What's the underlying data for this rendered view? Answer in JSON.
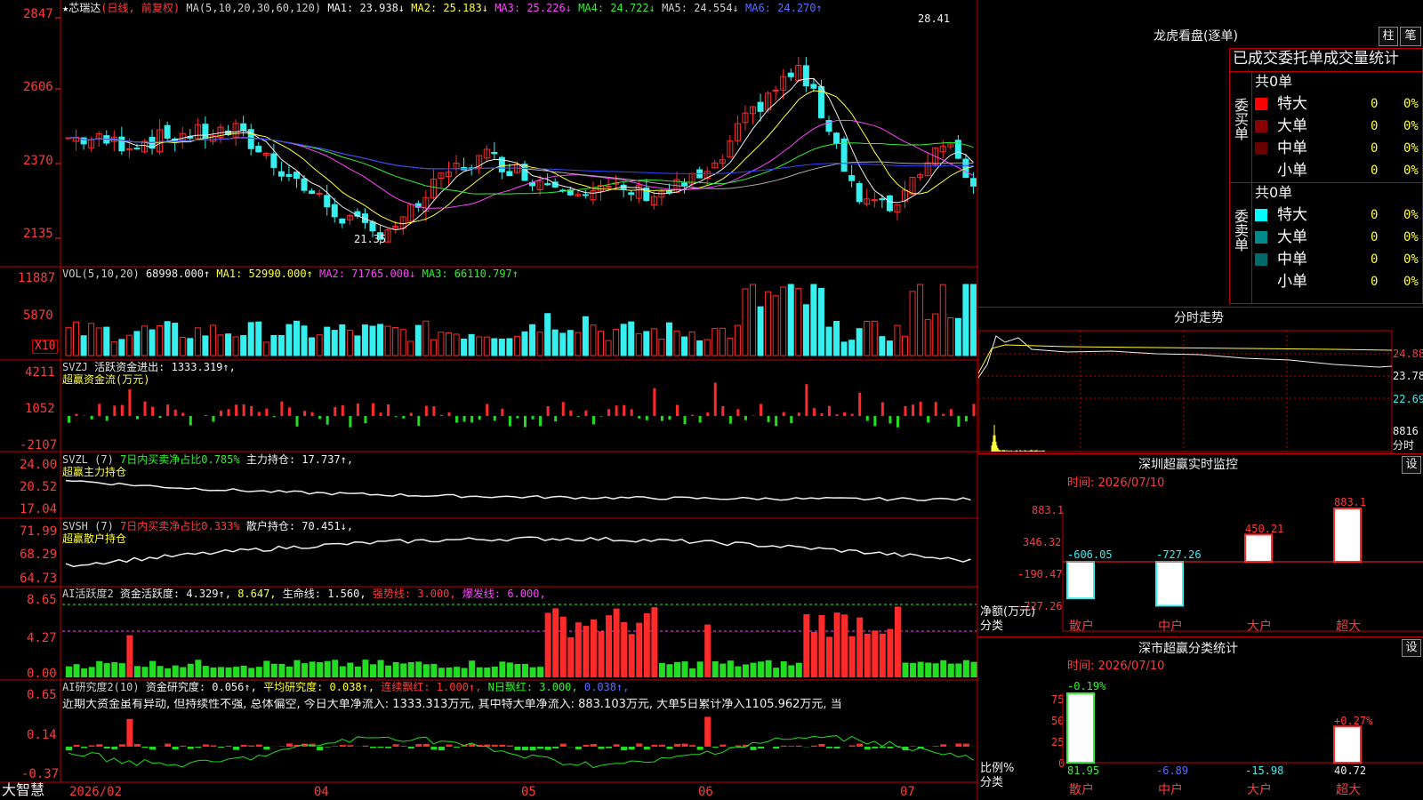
{
  "colors": {
    "up": "#ff2a2a",
    "down": "#36f0f0",
    "frame": "#c00000",
    "yellow": "#ffff33",
    "green": "#33ee33",
    "magenta": "#ff44ff",
    "white": "#f0f0f0",
    "blue": "#3344ff"
  },
  "stock": {
    "name": "★芯瑞达",
    "mode": "(日线, 前复权)"
  },
  "ma_legend": {
    "period": "MA(5,10,20,30,60,120)",
    "ma1": "MA1: 23.938↓",
    "ma2": "MA2: 25.183↓",
    "ma3": "MA3: 25.226↓",
    "ma4": "MA4: 24.722↓",
    "ma5": "MA5: 24.554↓",
    "ma6": "MA6: 24.270↑"
  },
  "price_axis": [
    "2847",
    "2606",
    "2370",
    "2135"
  ],
  "price_annotations": {
    "high": "28.41",
    "low": "21.35"
  },
  "vol": {
    "label": "VOL(5,10,20)",
    "value": "68998.000↑",
    "ma1": "MA1: 52990.000↑",
    "ma2": "MA2: 71765.000↓",
    "ma3": "MA3: 66110.797↑",
    "axis": [
      "11887",
      "5870"
    ],
    "unit": "X10"
  },
  "svzj": {
    "label": "SVZJ",
    "text": "活跃资金进出: 1333.319↑,",
    "sub": "超赢资金流(万元)",
    "axis": [
      "4211",
      "1052",
      "-2107"
    ]
  },
  "svzl": {
    "label": "SVZL (7)",
    "text1": "7日内买卖净占比0.785%",
    "text2": "主力持仓: 17.737↑,",
    "sub": "超赢主力持仓",
    "axis": [
      "24.00",
      "20.52",
      "17.04"
    ]
  },
  "svsh": {
    "label": "SVSH (7)",
    "text1": "7日内买卖净占比0.333%",
    "text2": "散户持仓: 70.451↓,",
    "sub": "超赢散户持仓",
    "axis": [
      "71.99",
      "68.29",
      "64.73"
    ]
  },
  "ai_active": {
    "label": "AI活跃度2",
    "text1": "资金活跃度: 4.329↑,",
    "text2": "8.647,",
    "text3": "生命线: 1.560,",
    "text4": "强势线: 3.000,",
    "text5": "爆发线: 6.000,",
    "axis": [
      "8.65",
      "4.27",
      "0.00"
    ]
  },
  "ai_research": {
    "label": "AI研究度2(10)",
    "text1": "资金研究度: 0.056↑,",
    "text2": "平均研究度: 0.038↑,",
    "text3": "连续飘红: 1.000↑,",
    "text4": "N日飘红: 3.000,",
    "text5": "0.038↑,",
    "commentary": "近期大资金虽有异动, 但持续性不强, 总体偏空, 今日大单净流入: 1333.313万元, 其中特大单净流入: 883.103万元, 大单5日累计净入1105.962万元, 当",
    "axis": [
      "0.65",
      "0.14",
      "-0.37"
    ]
  },
  "date_axis": {
    "brand": "大智慧",
    "labels": [
      "2026/02",
      "04",
      "05",
      "06",
      "07"
    ]
  },
  "dragon_tiger": {
    "title": "龙虎看盘(逐单)",
    "btn1": "柱",
    "btn2": "笔",
    "subtitle": "已成交委托单成交量统计",
    "buy_label": "委买单",
    "sell_label": "委卖单",
    "buy_total": "共0单",
    "sell_total": "共0单",
    "buy_rows": [
      {
        "name": "特大",
        "count": "0",
        "pct": "0%",
        "color": "#ff0000"
      },
      {
        "name": "大单",
        "count": "0",
        "pct": "0%",
        "color": "#8b0000"
      },
      {
        "name": "中单",
        "count": "0",
        "pct": "0%",
        "color": "#6a0000"
      },
      {
        "name": "小单",
        "count": "0",
        "pct": "0%",
        "color": "#000000"
      }
    ],
    "sell_rows": [
      {
        "name": "特大",
        "count": "0",
        "pct": "0%",
        "color": "#00ffff"
      },
      {
        "name": "大单",
        "count": "0",
        "pct": "0%",
        "color": "#008b8b"
      },
      {
        "name": "中单",
        "count": "0",
        "pct": "0%",
        "color": "#006a6a"
      },
      {
        "name": "小单",
        "count": "0",
        "pct": "0%",
        "color": "#000000"
      }
    ]
  },
  "intraday": {
    "title": "分时走势",
    "axis": [
      "24.88",
      "23.78",
      "22.69"
    ],
    "vol_axis": "8816",
    "vol_label": "分时"
  },
  "sz_monitor": {
    "title": "深圳超赢实时监控",
    "setting": "设",
    "time": "时间: 2026/07/10",
    "axis": [
      "883.1",
      "346.32",
      "-190.47",
      "-727.26"
    ],
    "ylabel": "净额(万元)",
    "xlabel": "分类",
    "categories": [
      "散户",
      "中户",
      "大户",
      "超大"
    ],
    "values": [
      -606.05,
      -727.26,
      450.21,
      883.1
    ],
    "value_labels": [
      "-606.05",
      "-727.26",
      "450.21",
      "883.1"
    ]
  },
  "sz_class": {
    "title": "深市超赢分类统计",
    "setting": "设",
    "time": "时间: 2026/07/10",
    "axis": [
      "75",
      "50",
      "25",
      "0"
    ],
    "ylabel": "比例%",
    "xlabel": "分类",
    "categories": [
      "散户",
      "中户",
      "大户",
      "超大"
    ],
    "top_labels": [
      "-0.19%",
      "",
      "",
      "+0.27%"
    ],
    "bottom_labels": [
      "81.95",
      "-6.89",
      "-15.98",
      "40.72"
    ]
  }
}
